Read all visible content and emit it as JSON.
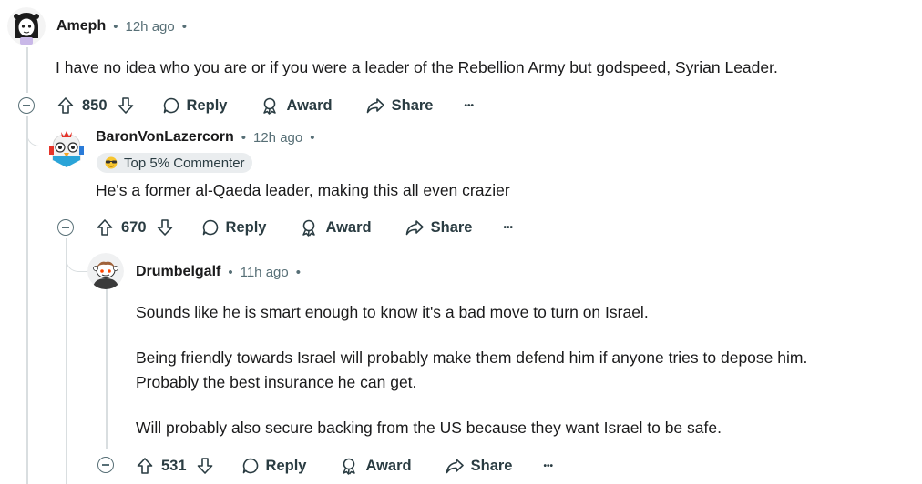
{
  "comments": [
    {
      "author": "Ameph",
      "time": "12h ago",
      "sep1": "•",
      "sep2": "•",
      "body": [
        "I have no idea who you are or if you were a leader of the Rebellion Army but godspeed, Syrian Leader."
      ],
      "votes": "850",
      "reply": "Reply",
      "award": "Award",
      "share": "Share",
      "more": "•••"
    },
    {
      "author": "BaronVonLazercorn",
      "time": "12h ago",
      "sep1": "•",
      "sep2": "•",
      "flair": "Top 5% Commenter",
      "body": [
        "He's a former al-Qaeda leader, making this all even crazier"
      ],
      "votes": "670",
      "reply": "Reply",
      "award": "Award",
      "share": "Share",
      "more": "•••"
    },
    {
      "author": "Drumbelgalf",
      "time": "11h ago",
      "sep1": "•",
      "sep2": "•",
      "body": [
        "Sounds like he is smart enough to know it's a bad move to turn on Israel.",
        "Being friendly towards Israel will probably make them defend him if anyone tries to depose him.",
        "Probably the best insurance he can get.",
        "Will probably also secure backing from the US because they want Israel to be safe."
      ],
      "votes": "531",
      "reply": "Reply",
      "award": "Award",
      "share": "Share",
      "more": "•••"
    }
  ],
  "colors": {
    "text": "#1a1a1b",
    "meta": "#576f76",
    "thread": "#d9dee0",
    "flair_bg": "#eaedef"
  }
}
